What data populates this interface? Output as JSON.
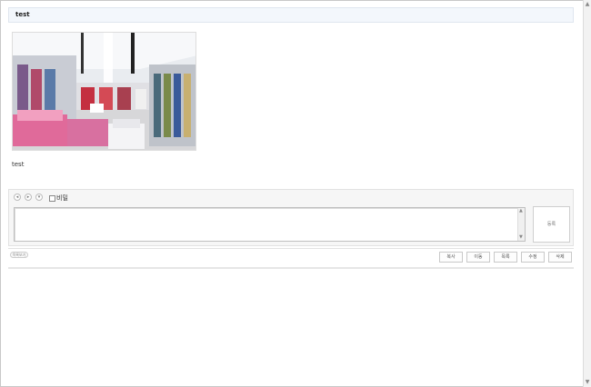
{
  "post": {
    "title": "test",
    "body": "test"
  },
  "comment": {
    "emoticons": [
      "◂",
      "▸",
      "▾"
    ],
    "secret_label": "비밀",
    "textarea_value": "",
    "submit_label": "등록"
  },
  "footer": {
    "list_label": "목록보기",
    "buttons": [
      "복사",
      "이동",
      "목록",
      "수정",
      "삭제"
    ]
  },
  "colors": {
    "title_bg": "#f3f7fc",
    "comment_bg": "#f6f6f6"
  }
}
